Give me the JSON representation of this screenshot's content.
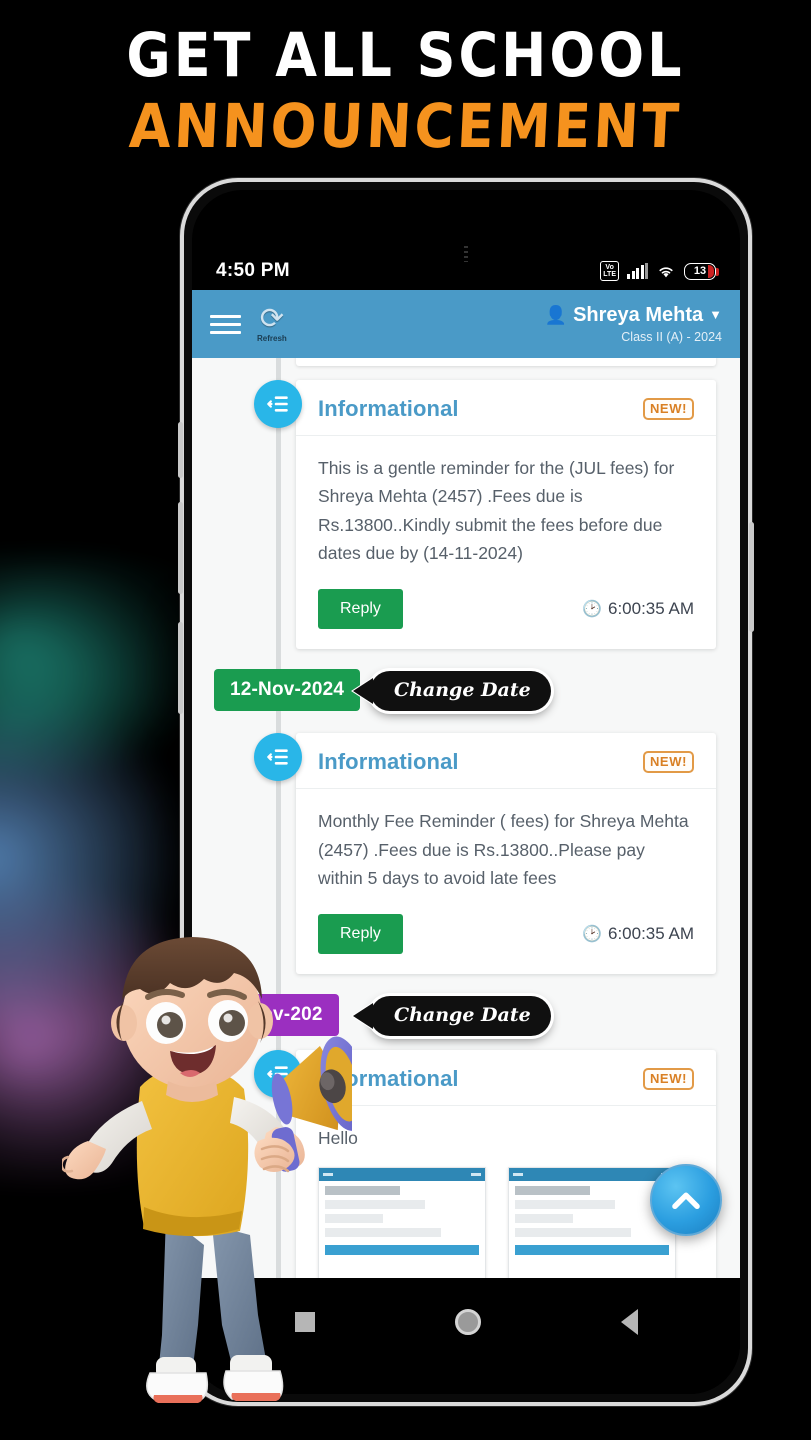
{
  "promo": {
    "headline_line1": "GET ALL SCHOOL",
    "headline_line2": "ANNOUNCEMENT"
  },
  "status_bar": {
    "time": "4:50 PM",
    "network_label": "VoLTE",
    "volte_top": "Vo",
    "volte_bottom": "LTE",
    "wifi_icon": "wifi-icon",
    "signal_icon": "signal-bars-icon",
    "battery_level": "13"
  },
  "app_bar": {
    "menu_icon": "hamburger-menu-icon",
    "refresh_icon": "refresh-icon",
    "refresh_label": "Refresh",
    "user_icon": "person-icon",
    "user_name": "Shreya Mehta",
    "dropdown_icon": "caret-down-icon",
    "class_label": "Class II (A) - 2024"
  },
  "colors": {
    "app_bar": "#4a9ac7",
    "accent_blue": "#29b6e8",
    "reply_green": "#1a9c50",
    "date_purple": "#9b2fc0",
    "new_orange": "#d98024",
    "headline_orange": "#F5921E"
  },
  "callouts": [
    {
      "label": "Change Date"
    },
    {
      "label": "Change Date"
    }
  ],
  "timeline": [
    {
      "node_icon": "announcement-list-icon",
      "title": "Informational",
      "badge": "NEW!",
      "body": "This is a gentle reminder for the (JUL fees) for Shreya Mehta (2457) .Fees due is Rs.13800..Kindly submit the fees before due dates due by (14-11-2024)",
      "reply_label": "Reply",
      "time": "6:00:35 AM",
      "clock_icon": "clock-icon"
    },
    {
      "date_chip": "12-Nov-2024",
      "date_chip_color": "green",
      "change_date_label": "Change Date",
      "node_icon": "announcement-list-icon",
      "title": "Informational",
      "badge": "NEW!",
      "body": "Monthly Fee Reminder ( fees) for Shreya Mehta (2457) .Fees due is Rs.13800..Please pay within 5 days to avoid late fees",
      "reply_label": "Reply",
      "time": "6:00:35 AM",
      "clock_icon": "clock-icon"
    },
    {
      "date_chip": "9-Nov-202",
      "date_chip_color": "purple",
      "change_date_label": "Change Date",
      "node_icon": "announcement-list-icon",
      "title": "Informational",
      "badge": "NEW!",
      "body": "Hello",
      "attachments": [
        {
          "name": "attachment-thumbnail-1"
        },
        {
          "name": "attachment-thumbnail-2"
        }
      ]
    }
  ],
  "fab": {
    "icon": "chevron-up-icon"
  },
  "nav_bar": {
    "recents_icon": "recents-square-icon",
    "home_icon": "home-circle-icon",
    "back_icon": "back-triangle-icon"
  },
  "illustration": {
    "name": "boy-with-megaphone-3d"
  }
}
